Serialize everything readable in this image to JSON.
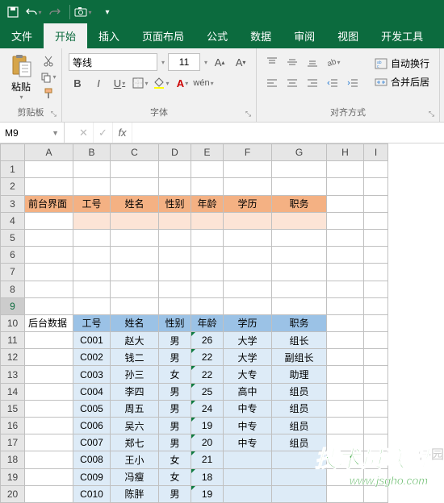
{
  "qat": {
    "save": "save",
    "undo": "undo",
    "redo": "redo",
    "camera": "camera"
  },
  "tabs": {
    "file": "文件",
    "home": "开始",
    "insert": "插入",
    "layout": "页面布局",
    "formulas": "公式",
    "data": "数据",
    "review": "审阅",
    "view": "视图",
    "developer": "开发工具"
  },
  "ribbon": {
    "clipboard": {
      "label": "剪贴板",
      "paste": "粘贴"
    },
    "font": {
      "label": "字体",
      "name": "等线",
      "size": "11"
    },
    "alignment": {
      "label": "对齐方式",
      "wrap": "自动换行",
      "merge": "合并后居"
    }
  },
  "namebox": "M9",
  "columns": [
    "A",
    "B",
    "C",
    "D",
    "E",
    "F",
    "G",
    "H",
    "I"
  ],
  "rows": [
    "1",
    "2",
    "3",
    "4",
    "5",
    "6",
    "7",
    "8",
    "9",
    "10",
    "11",
    "12",
    "13",
    "14",
    "15",
    "16",
    "17",
    "18",
    "19",
    "20"
  ],
  "front_label": "前台界面",
  "back_label": "后台数据",
  "headers": {
    "id": "工号",
    "name": "姓名",
    "gender": "性别",
    "age": "年龄",
    "edu": "学历",
    "title": "职务"
  },
  "records": [
    {
      "id": "C001",
      "name": "赵大",
      "gender": "男",
      "age": "26",
      "edu": "大学",
      "title": "组长"
    },
    {
      "id": "C002",
      "name": "钱二",
      "gender": "男",
      "age": "22",
      "edu": "大学",
      "title": "副组长"
    },
    {
      "id": "C003",
      "name": "孙三",
      "gender": "女",
      "age": "22",
      "edu": "大专",
      "title": "助理"
    },
    {
      "id": "C004",
      "name": "李四",
      "gender": "男",
      "age": "25",
      "edu": "高中",
      "title": "组员"
    },
    {
      "id": "C005",
      "name": "周五",
      "gender": "男",
      "age": "24",
      "edu": "中专",
      "title": "组员"
    },
    {
      "id": "C006",
      "name": "吴六",
      "gender": "男",
      "age": "19",
      "edu": "中专",
      "title": "组员"
    },
    {
      "id": "C007",
      "name": "郑七",
      "gender": "男",
      "age": "20",
      "edu": "中专",
      "title": "组员"
    },
    {
      "id": "C008",
      "name": "王小",
      "gender": "女",
      "age": "21",
      "edu": "",
      "title": ""
    },
    {
      "id": "C009",
      "name": "冯瘦",
      "gender": "女",
      "age": "18",
      "edu": "",
      "title": ""
    },
    {
      "id": "C010",
      "name": "陈胖",
      "gender": "男",
      "age": "19",
      "edu": "",
      "title": ""
    }
  ],
  "watermark": {
    "line1": "技术员联盟",
    "line2": "www.jsgho.com",
    "side": "件园"
  }
}
